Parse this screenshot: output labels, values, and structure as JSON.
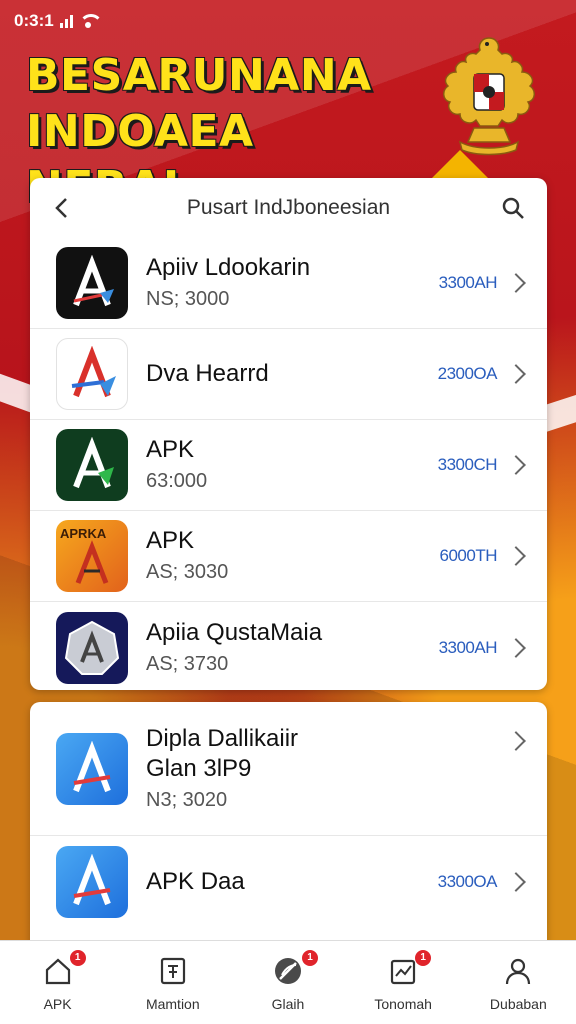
{
  "status_bar": {
    "time": "0:3:1"
  },
  "banner": {
    "line1": "BESARUNANA",
    "line2": "INDOAEA NERAI"
  },
  "header": {
    "title": "Pusart IndJboneesian"
  },
  "apps": [
    {
      "name": "Apiiv Ldookarin",
      "sub": "NS; 3000",
      "size": "3300AH",
      "icon": "app-a-black-icon"
    },
    {
      "name": "Dva Hearrd",
      "sub": "",
      "size": "2300OA",
      "icon": "app-a-white-icon"
    },
    {
      "name": "APK",
      "sub": "63:000",
      "size": "3300CH",
      "icon": "app-a-green-icon"
    },
    {
      "name": "APK",
      "sub": "AS; 3030",
      "size": "6000TH",
      "icon": "app-a-orange-icon",
      "icon_text": "APRKA"
    },
    {
      "name": "Apiia QustaMaia",
      "sub": "AS; 3730",
      "size": "3300AH",
      "icon": "app-a-navy-icon"
    }
  ],
  "apps2": [
    {
      "name": "Dipla Dallikaiir",
      "name2": "Glan 3lP9",
      "sub": "N3; 3020",
      "size": "",
      "icon": "app-a-blue-icon"
    },
    {
      "name": "APK Daa",
      "sub": "",
      "size": "3300OA",
      "icon": "app-a-blue2-icon"
    }
  ],
  "nav": [
    {
      "label": "APK",
      "badge": "1",
      "icon": "home-icon"
    },
    {
      "label": "Mamtion",
      "badge": "",
      "icon": "bookmark-icon"
    },
    {
      "label": "Glaih",
      "badge": "1",
      "icon": "compass-icon"
    },
    {
      "label": "Tonomah",
      "badge": "1",
      "icon": "chart-icon"
    },
    {
      "label": "Dubaban",
      "badge": "",
      "icon": "profile-icon"
    }
  ],
  "colors": {
    "accent": "#2a5dbd",
    "brand_red": "#c41a1f",
    "banner_yellow": "#ffe21a",
    "badge": "#e0242b"
  }
}
